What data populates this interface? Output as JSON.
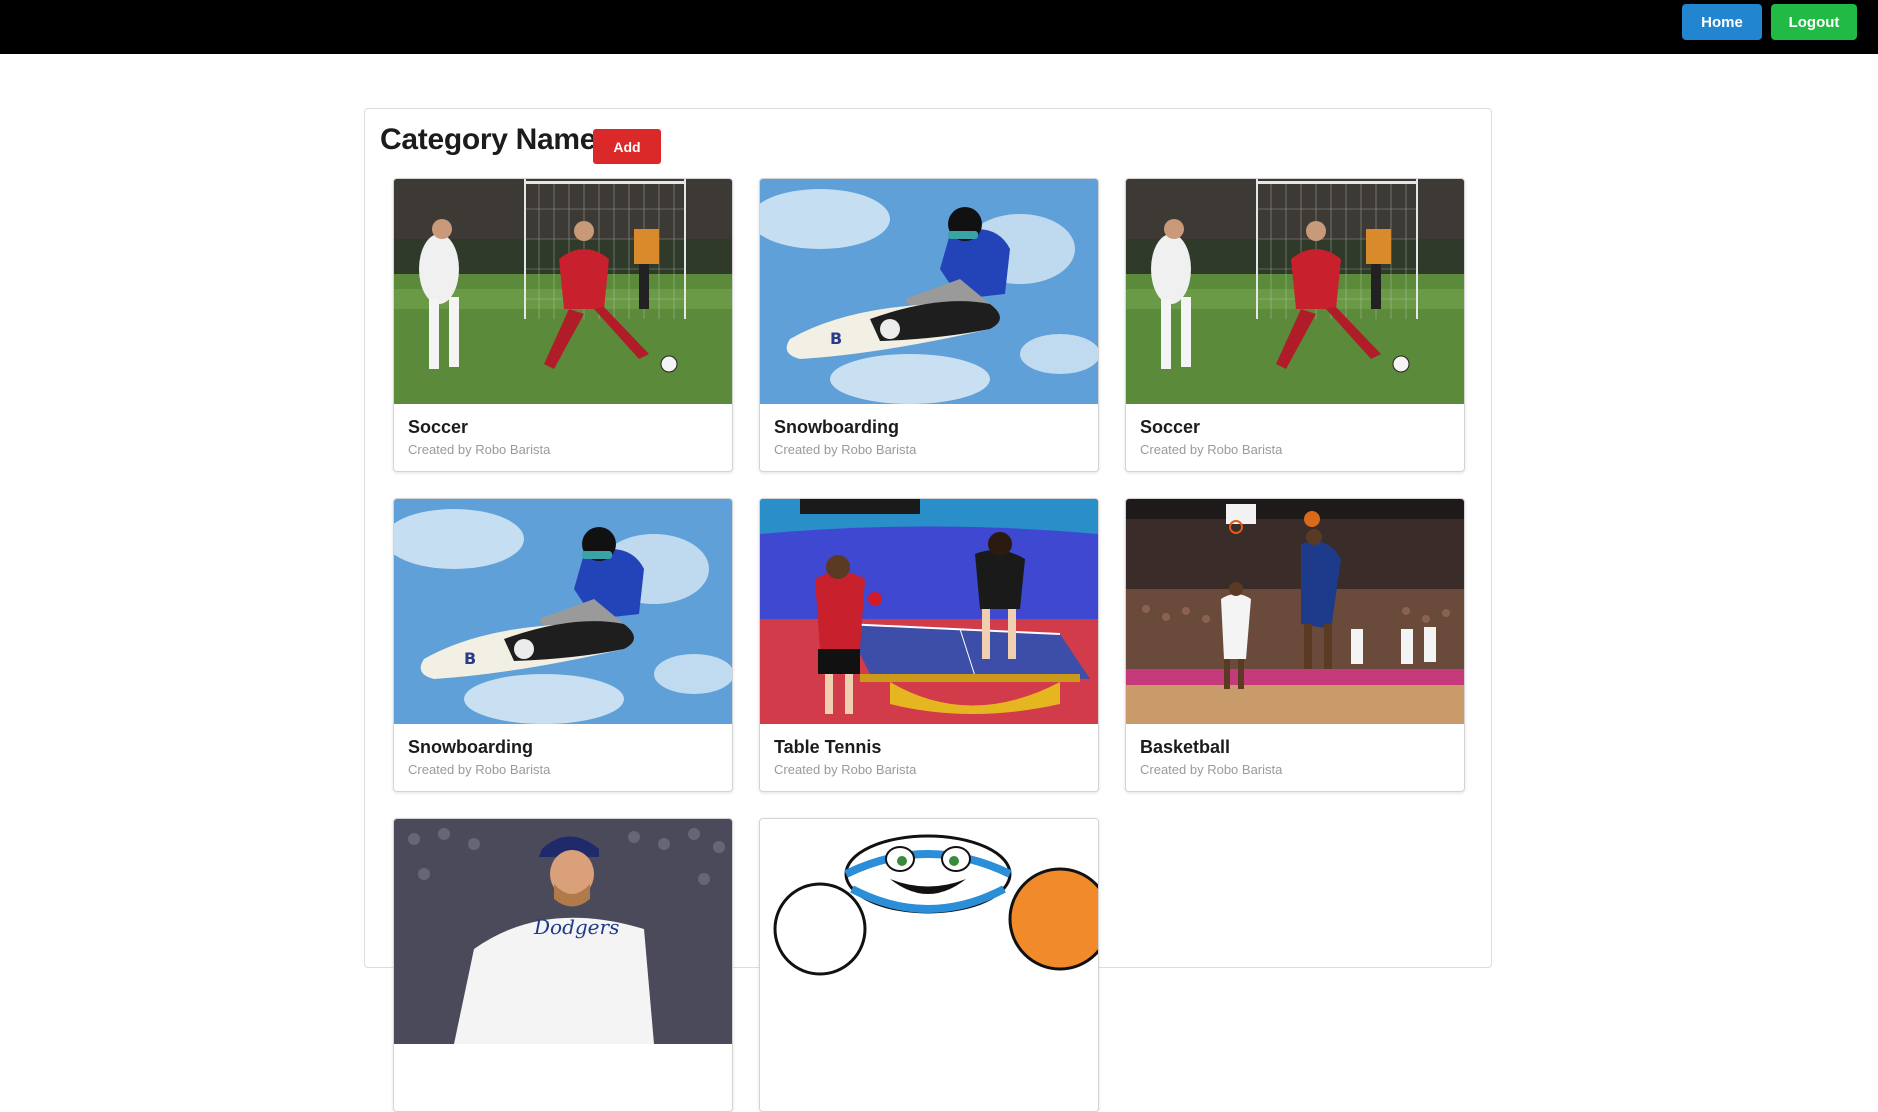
{
  "header": {
    "home_label": "Home",
    "logout_label": "Logout",
    "colors": {
      "bar": "#000000",
      "home": "#2185d0",
      "logout": "#21ba45"
    }
  },
  "main": {
    "title": "Category Names",
    "add_label": "Add",
    "add_color": "#db2828"
  },
  "cards": [
    {
      "title": "Soccer",
      "meta": "Created by Robo Barista",
      "image": "soccer-photo"
    },
    {
      "title": "Snowboarding",
      "meta": "Created by Robo Barista",
      "image": "snowboard-photo"
    },
    {
      "title": "Soccer",
      "meta": "Created by Robo Barista",
      "image": "soccer-photo"
    },
    {
      "title": "Snowboarding",
      "meta": "Created by Robo Barista",
      "image": "snowboard-photo"
    },
    {
      "title": "Table Tennis",
      "meta": "Created by Robo Barista",
      "image": "table-tennis-photo"
    },
    {
      "title": "Basketball",
      "meta": "Created by Robo Barista",
      "image": "basketball-photo"
    },
    {
      "title": "",
      "meta": "",
      "image": "baseball-pitcher-photo"
    },
    {
      "title": "",
      "meta": "",
      "image": "cartoon-mascot-illustration"
    }
  ]
}
